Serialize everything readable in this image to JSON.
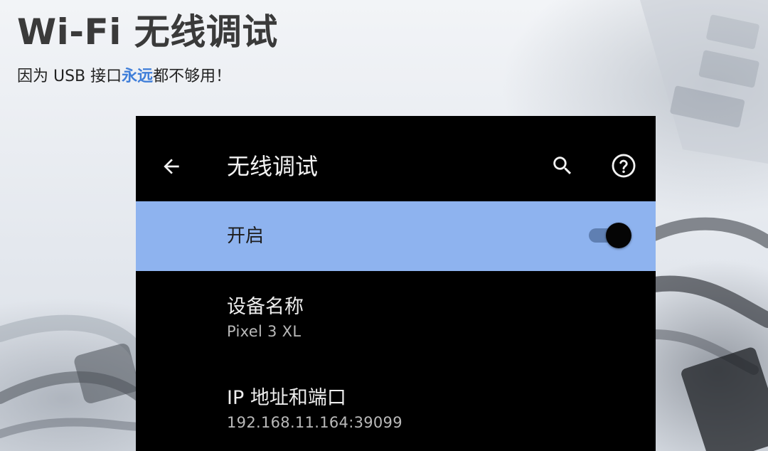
{
  "headline": "Wi-Fi 无线调试",
  "subline": {
    "before": "因为 USB 接口",
    "highlight": "永远",
    "after": "都不够用！"
  },
  "colors": {
    "headline": "#3a3a3a",
    "highlight": "#3f7ed9",
    "panel_bg": "#000000",
    "toggle_row_bg": "#8eb3ef",
    "switch_track": "#5f7fb2"
  },
  "appbar": {
    "title": "无线调试",
    "back_icon": "arrow-back-icon",
    "search_icon": "search-icon",
    "help_icon": "help-circle-icon"
  },
  "toggle": {
    "label": "开启",
    "state": "on"
  },
  "info": [
    {
      "title": "设备名称",
      "value": "Pixel 3 XL"
    },
    {
      "title": "IP 地址和端口",
      "value": "192.168.11.164:39099"
    }
  ]
}
